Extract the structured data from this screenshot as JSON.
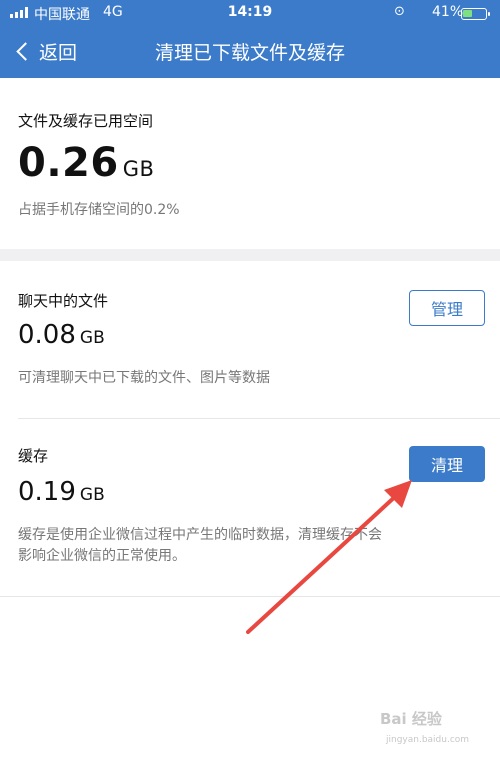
{
  "status_bar": {
    "carrier": "中国联通",
    "network": "4G",
    "time": "14:19",
    "battery": "41%",
    "icons": [
      "signal-icon",
      "rotation-lock-icon",
      "alarm-icon",
      "battery-icon"
    ]
  },
  "nav": {
    "back_label": "返回",
    "title": "清理已下载文件及缓存"
  },
  "summary": {
    "label": "文件及缓存已用空间",
    "value": "0.26",
    "unit": "GB",
    "note": "占据手机存储空间的0.2%"
  },
  "chat_files": {
    "label": "聊天中的文件",
    "value": "0.08",
    "unit": "GB",
    "note": "可清理聊天中已下载的文件、图片等数据",
    "button_label": "管理"
  },
  "cache": {
    "label": "缓存",
    "value": "0.19",
    "unit": "GB",
    "note_line1": "缓存是使用企业微信过程中产生的临时数据，清理缓存不会",
    "note_line2": "影响企业微信的正常使用。",
    "button_label": "清理"
  },
  "watermark": {
    "text": "Bai 经验",
    "sub": "jingyan.baidu.com"
  },
  "colors": {
    "header": "#3b7bc9",
    "accent": "#3b7bc9",
    "arrow": "#e8483f",
    "gap": "#f0f0f2"
  }
}
